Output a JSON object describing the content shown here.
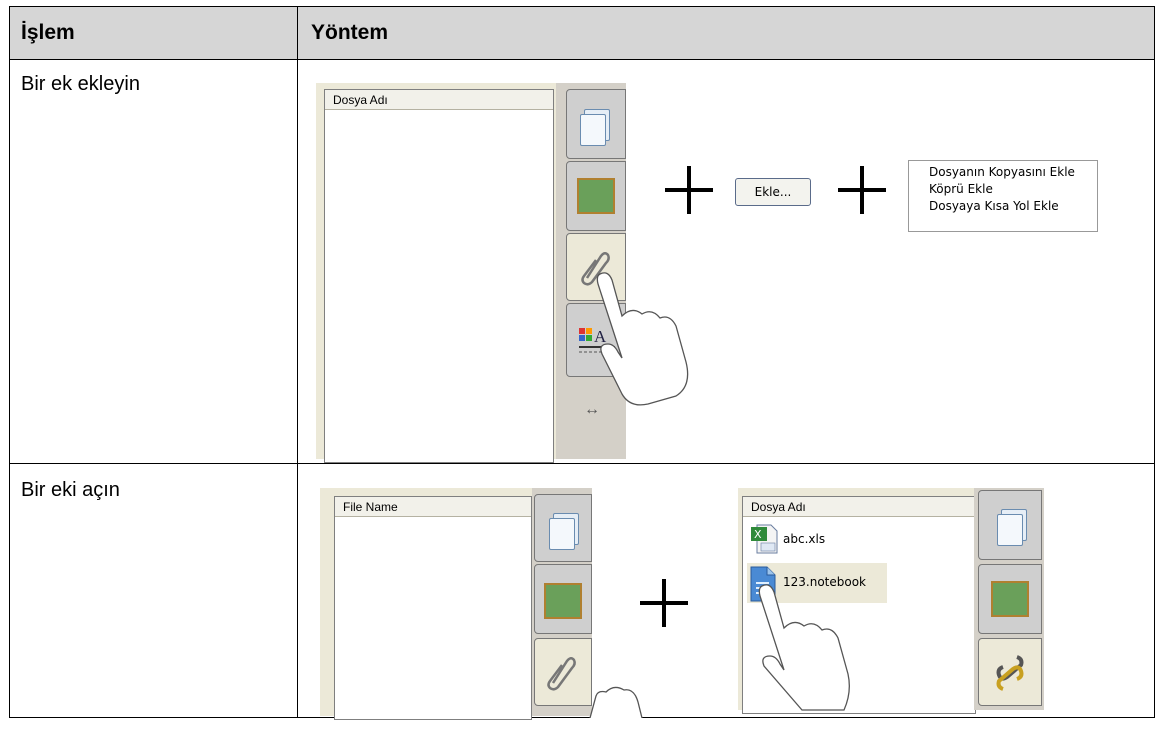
{
  "table": {
    "header": {
      "col1": "İşlem",
      "col2": "Yöntem"
    },
    "rows": [
      {
        "action": "Bir ek ekleyin"
      },
      {
        "action": "Bir eki açın"
      }
    ]
  },
  "row1": {
    "list_header": "Dosya Adı",
    "button_label": "Ekle...",
    "menu_items": [
      "Dosyanın Kopyasını Ekle",
      "Köprü Ekle",
      "Dosyaya Kısa Yol Ekle"
    ],
    "arrow_glyph": "↔"
  },
  "row2": {
    "left_list_header": "File Name",
    "right_list_header": "Dosya Adı",
    "files": [
      "abc.xls",
      "123.notebook"
    ]
  },
  "icons": [
    "blank-page-icon",
    "gallery-icon",
    "paperclip-icon",
    "properties-icon",
    "hand-pointer-icon",
    "plus-icon",
    "excel-file-icon",
    "notebook-file-icon",
    "link-icon"
  ]
}
